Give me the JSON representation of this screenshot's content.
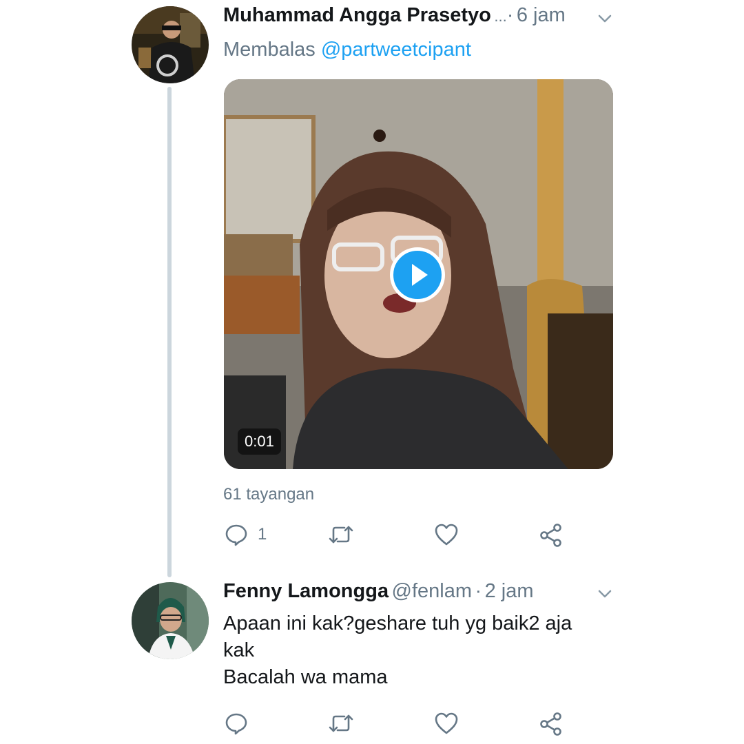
{
  "tweets": [
    {
      "author": "Muhammad Angga Prasetyo",
      "handle_truncated": "...",
      "separator": "·",
      "time": "6 jam",
      "reply_prefix": "Membalas",
      "reply_to": "@partweetcipant",
      "video": {
        "duration": "0:01"
      },
      "views": "61 tayangan",
      "actions": {
        "reply_count": "1",
        "retweet_count": "",
        "like_count": ""
      }
    },
    {
      "author": "Fenny Lamongga",
      "handle": "@fenlam",
      "separator": "·",
      "time": "2 jam",
      "text_lines": [
        "Apaan ini kak?geshare tuh yg baik2 aja",
        "kak",
        "Bacalah wa mama"
      ],
      "actions": {
        "reply_count": "",
        "retweet_count": "",
        "like_count": ""
      }
    }
  ],
  "icons": {
    "reply": "reply-icon",
    "retweet": "retweet-icon",
    "like": "like-icon",
    "share": "share-icon",
    "menu": "chevron-down-icon",
    "play": "play-icon"
  },
  "colors": {
    "accent": "#1da1f2",
    "secondary_text": "#657786",
    "primary_text": "#14171a",
    "thread_line": "#ccd6dd"
  }
}
